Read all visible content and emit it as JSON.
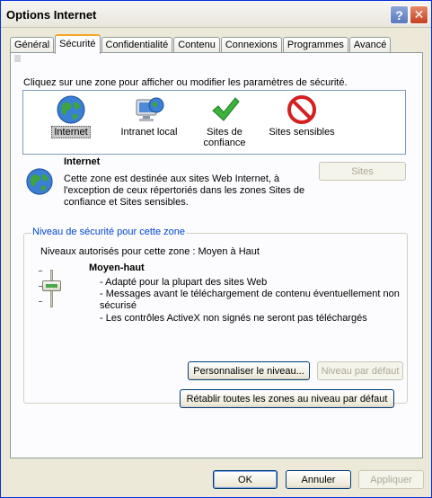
{
  "window": {
    "title": "Options Internet",
    "help_glyph": "?",
    "close_glyph": "✕"
  },
  "tabs": [
    {
      "label": "Général",
      "active": false
    },
    {
      "label": "Sécurité",
      "active": true
    },
    {
      "label": "Confidentialité",
      "active": false
    },
    {
      "label": "Contenu",
      "active": false
    },
    {
      "label": "Connexions",
      "active": false
    },
    {
      "label": "Programmes",
      "active": false
    },
    {
      "label": "Avancé",
      "active": false
    }
  ],
  "security": {
    "instruction": "Cliquez sur une zone pour afficher ou modifier les paramètres de sécurité.",
    "zones": [
      {
        "label": "Internet",
        "icon": "globe-icon",
        "selected": true
      },
      {
        "label": "Intranet local",
        "icon": "intranet-icon",
        "selected": false
      },
      {
        "label_line1": "Sites de",
        "label_line2": "confiance",
        "icon": "checkmark-icon",
        "selected": false
      },
      {
        "label": "Sites sensibles",
        "icon": "no-entry-icon",
        "selected": false
      }
    ],
    "zone_detail": {
      "name": "Internet",
      "desc_line1": "Cette zone est destinée aux sites Web Internet, à",
      "desc_line2": "l'exception de ceux répertoriés dans les zones Sites de",
      "desc_line3": "confiance et Sites sensibles.",
      "sites_button": "Sites"
    },
    "level": {
      "group_title": "Niveau de sécurité pour cette zone",
      "allowed": "Niveaux autorisés pour cette zone : Moyen à Haut",
      "level_name": "Moyen-haut",
      "bullet1": "- Adapté pour la plupart des sites Web",
      "bullet2": "- Messages avant le téléchargement de contenu éventuellement non",
      "bullet2_cont": "sécurisé",
      "bullet3": "- Les contrôles ActiveX non signés ne seront pas téléchargés",
      "custom_button": "Personnaliser le niveau...",
      "default_button": "Niveau par défaut"
    },
    "reset_button": "Rétablir toutes les zones au niveau par défaut"
  },
  "footer": {
    "ok": "OK",
    "cancel": "Annuler",
    "apply": "Appliquer"
  },
  "colors": {
    "accent_tab": "#f5a623",
    "group_title": "#0046d5",
    "window_bg": "#ece9d8"
  }
}
